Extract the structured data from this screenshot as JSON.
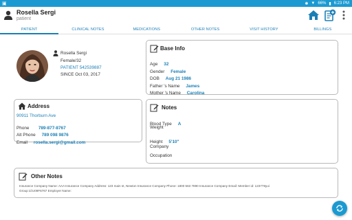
{
  "status_bar": {
    "battery": "66%",
    "time": "6:23 PM"
  },
  "header": {
    "name": "Rosella  Sergi",
    "role": "patient"
  },
  "tabs": [
    {
      "label": "PATIENT",
      "active": true
    },
    {
      "label": "CLINICAL NOTES",
      "active": false
    },
    {
      "label": "MEDICATIONS",
      "active": false
    },
    {
      "label": "OTHER NOTES",
      "active": false
    },
    {
      "label": "VISIT HISTORY",
      "active": false
    },
    {
      "label": "BILLINGS",
      "active": false
    }
  ],
  "profile": {
    "name": "Rosella  Sergi",
    "gender_age": "Female/32",
    "patient_id": "PATIENT 542539887",
    "since": "SINCE Oct 03, 2017"
  },
  "base_info": {
    "title": "Base Info",
    "age_label": "Age",
    "age": "32",
    "gender_label": "Gender",
    "gender": "Female",
    "dob_label": "DOB",
    "dob": "Aug 21 1986",
    "father_label": "Father 's Name",
    "father": "James",
    "mother_label": "Mother 's Name",
    "mother": "Carolina"
  },
  "address": {
    "title": "Address",
    "street": "90911 Thorburn Ave",
    "phone_label": "Phone",
    "phone": "789-877-8767",
    "alt_phone_label": "Alt Phone",
    "alt_phone": "789 098 9876",
    "email_label": "Email",
    "email": "rosella.sergi@gmail.com"
  },
  "notes": {
    "title": "Notes",
    "blood_type_label": "Blood Type",
    "blood_type": "A",
    "weight_label": "Weight",
    "height_label": "Height",
    "height": "5'10\"",
    "company_label": "Company",
    "occupation_label": "Occupation"
  },
  "other_notes": {
    "title": "Other Notes",
    "text_line1": "Insurance Company Name: AAA Insurance Company Address: 123 main st, Newton      Insurance Company Phone: 1800 563 7890 Insurance Company Email: Member id: 123778yui",
    "text_line2": "Group id:U09F6767 Employer Name:"
  },
  "colors": {
    "accent": "#1b9ad1",
    "value_text": "#1b7fb6"
  }
}
